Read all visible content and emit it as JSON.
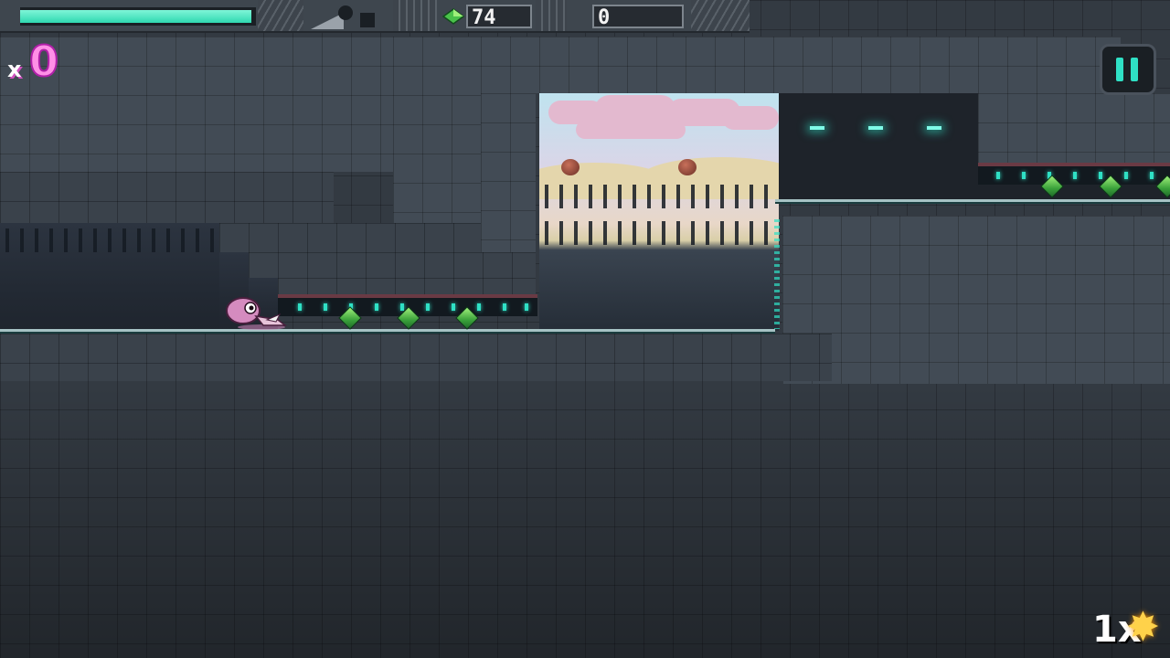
{
  "hud": {
    "health_fraction": 0.98,
    "health_color": "#2fd8b0",
    "gem_icon": "green-gem-icon",
    "gem_count": "74",
    "score": "0",
    "pause_icon": "pause-icon"
  },
  "combo": {
    "prefix": "x",
    "value": "0"
  },
  "multiplier": {
    "label": "1x",
    "icon": "explosion-burst-icon"
  },
  "level": {
    "collectibles_visible": 6,
    "colors": {
      "accent": "#2fe0c5",
      "gem": "#3aa13a",
      "player": "#d58bbf"
    }
  }
}
